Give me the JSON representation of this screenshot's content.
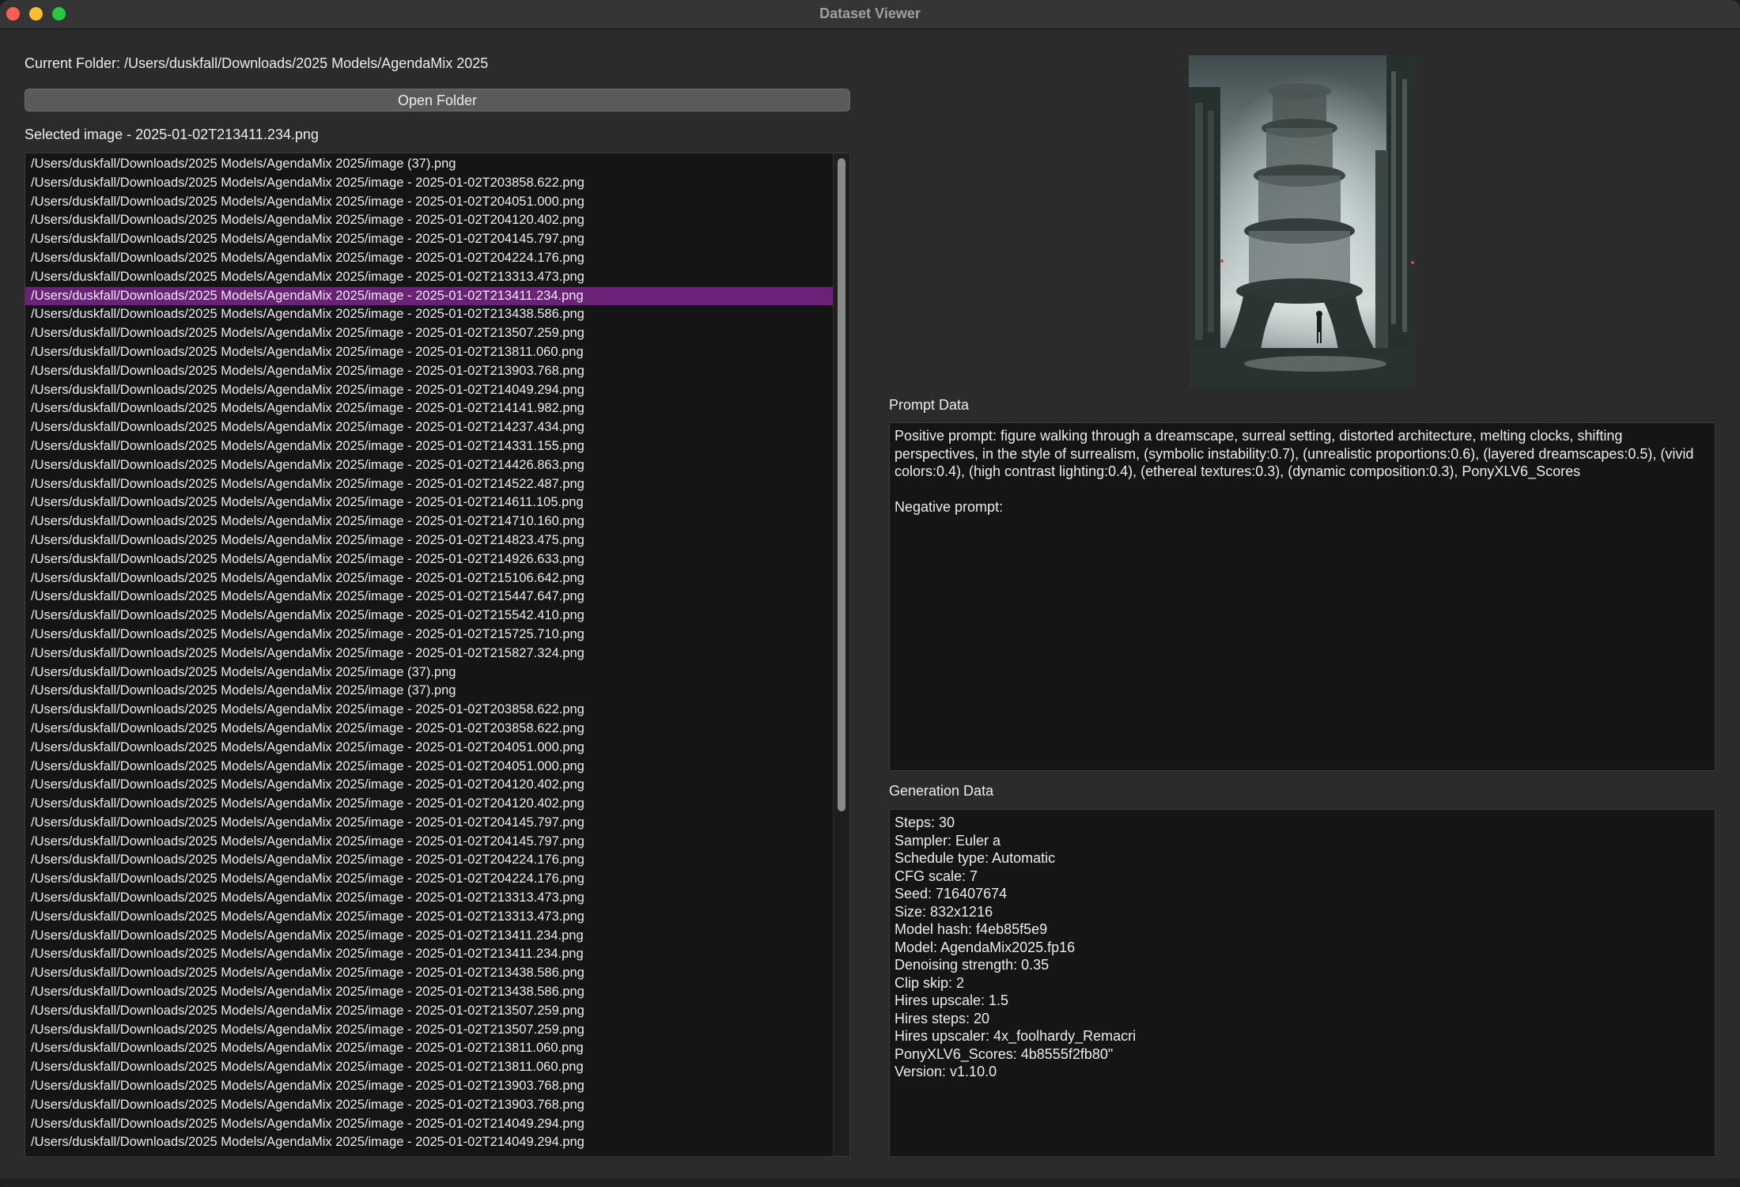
{
  "window": {
    "title": "Dataset Viewer"
  },
  "folder": {
    "current_label": "Current Folder: /Users/duskfall/Downloads/2025 Models/AgendaMix 2025",
    "open_button": "Open Folder",
    "selected_label": "Selected image - 2025-01-02T213411.234.png"
  },
  "files": {
    "selected_index": 7,
    "items": [
      "/Users/duskfall/Downloads/2025 Models/AgendaMix 2025/image (37).png",
      "/Users/duskfall/Downloads/2025 Models/AgendaMix 2025/image - 2025-01-02T203858.622.png",
      "/Users/duskfall/Downloads/2025 Models/AgendaMix 2025/image - 2025-01-02T204051.000.png",
      "/Users/duskfall/Downloads/2025 Models/AgendaMix 2025/image - 2025-01-02T204120.402.png",
      "/Users/duskfall/Downloads/2025 Models/AgendaMix 2025/image - 2025-01-02T204145.797.png",
      "/Users/duskfall/Downloads/2025 Models/AgendaMix 2025/image - 2025-01-02T204224.176.png",
      "/Users/duskfall/Downloads/2025 Models/AgendaMix 2025/image - 2025-01-02T213313.473.png",
      "/Users/duskfall/Downloads/2025 Models/AgendaMix 2025/image - 2025-01-02T213411.234.png",
      "/Users/duskfall/Downloads/2025 Models/AgendaMix 2025/image - 2025-01-02T213438.586.png",
      "/Users/duskfall/Downloads/2025 Models/AgendaMix 2025/image - 2025-01-02T213507.259.png",
      "/Users/duskfall/Downloads/2025 Models/AgendaMix 2025/image - 2025-01-02T213811.060.png",
      "/Users/duskfall/Downloads/2025 Models/AgendaMix 2025/image - 2025-01-02T213903.768.png",
      "/Users/duskfall/Downloads/2025 Models/AgendaMix 2025/image - 2025-01-02T214049.294.png",
      "/Users/duskfall/Downloads/2025 Models/AgendaMix 2025/image - 2025-01-02T214141.982.png",
      "/Users/duskfall/Downloads/2025 Models/AgendaMix 2025/image - 2025-01-02T214237.434.png",
      "/Users/duskfall/Downloads/2025 Models/AgendaMix 2025/image - 2025-01-02T214331.155.png",
      "/Users/duskfall/Downloads/2025 Models/AgendaMix 2025/image - 2025-01-02T214426.863.png",
      "/Users/duskfall/Downloads/2025 Models/AgendaMix 2025/image - 2025-01-02T214522.487.png",
      "/Users/duskfall/Downloads/2025 Models/AgendaMix 2025/image - 2025-01-02T214611.105.png",
      "/Users/duskfall/Downloads/2025 Models/AgendaMix 2025/image - 2025-01-02T214710.160.png",
      "/Users/duskfall/Downloads/2025 Models/AgendaMix 2025/image - 2025-01-02T214823.475.png",
      "/Users/duskfall/Downloads/2025 Models/AgendaMix 2025/image - 2025-01-02T214926.633.png",
      "/Users/duskfall/Downloads/2025 Models/AgendaMix 2025/image - 2025-01-02T215106.642.png",
      "/Users/duskfall/Downloads/2025 Models/AgendaMix 2025/image - 2025-01-02T215447.647.png",
      "/Users/duskfall/Downloads/2025 Models/AgendaMix 2025/image - 2025-01-02T215542.410.png",
      "/Users/duskfall/Downloads/2025 Models/AgendaMix 2025/image - 2025-01-02T215725.710.png",
      "/Users/duskfall/Downloads/2025 Models/AgendaMix 2025/image - 2025-01-02T215827.324.png",
      "/Users/duskfall/Downloads/2025 Models/AgendaMix 2025/image (37).png",
      "/Users/duskfall/Downloads/2025 Models/AgendaMix 2025/image (37).png",
      "/Users/duskfall/Downloads/2025 Models/AgendaMix 2025/image - 2025-01-02T203858.622.png",
      "/Users/duskfall/Downloads/2025 Models/AgendaMix 2025/image - 2025-01-02T203858.622.png",
      "/Users/duskfall/Downloads/2025 Models/AgendaMix 2025/image - 2025-01-02T204051.000.png",
      "/Users/duskfall/Downloads/2025 Models/AgendaMix 2025/image - 2025-01-02T204051.000.png",
      "/Users/duskfall/Downloads/2025 Models/AgendaMix 2025/image - 2025-01-02T204120.402.png",
      "/Users/duskfall/Downloads/2025 Models/AgendaMix 2025/image - 2025-01-02T204120.402.png",
      "/Users/duskfall/Downloads/2025 Models/AgendaMix 2025/image - 2025-01-02T204145.797.png",
      "/Users/duskfall/Downloads/2025 Models/AgendaMix 2025/image - 2025-01-02T204145.797.png",
      "/Users/duskfall/Downloads/2025 Models/AgendaMix 2025/image - 2025-01-02T204224.176.png",
      "/Users/duskfall/Downloads/2025 Models/AgendaMix 2025/image - 2025-01-02T204224.176.png",
      "/Users/duskfall/Downloads/2025 Models/AgendaMix 2025/image - 2025-01-02T213313.473.png",
      "/Users/duskfall/Downloads/2025 Models/AgendaMix 2025/image - 2025-01-02T213313.473.png",
      "/Users/duskfall/Downloads/2025 Models/AgendaMix 2025/image - 2025-01-02T213411.234.png",
      "/Users/duskfall/Downloads/2025 Models/AgendaMix 2025/image - 2025-01-02T213411.234.png",
      "/Users/duskfall/Downloads/2025 Models/AgendaMix 2025/image - 2025-01-02T213438.586.png",
      "/Users/duskfall/Downloads/2025 Models/AgendaMix 2025/image - 2025-01-02T213438.586.png",
      "/Users/duskfall/Downloads/2025 Models/AgendaMix 2025/image - 2025-01-02T213507.259.png",
      "/Users/duskfall/Downloads/2025 Models/AgendaMix 2025/image - 2025-01-02T213507.259.png",
      "/Users/duskfall/Downloads/2025 Models/AgendaMix 2025/image - 2025-01-02T213811.060.png",
      "/Users/duskfall/Downloads/2025 Models/AgendaMix 2025/image - 2025-01-02T213811.060.png",
      "/Users/duskfall/Downloads/2025 Models/AgendaMix 2025/image - 2025-01-02T213903.768.png",
      "/Users/duskfall/Downloads/2025 Models/AgendaMix 2025/image - 2025-01-02T213903.768.png",
      "/Users/duskfall/Downloads/2025 Models/AgendaMix 2025/image - 2025-01-02T214049.294.png",
      "/Users/duskfall/Downloads/2025 Models/AgendaMix 2025/image - 2025-01-02T214049.294.png"
    ]
  },
  "prompt": {
    "heading": "Prompt Data",
    "positive": "Positive prompt: figure walking through a dreamscape, surreal setting, distorted architecture, melting clocks, shifting perspectives, in the style of surrealism, (symbolic instability:0.7), (unrealistic proportions:0.6), (layered dreamscapes:0.5), (vivid colors:0.4), (high contrast lighting:0.4), (ethereal textures:0.3), (dynamic composition:0.3), PonyXLV6_Scores",
    "negative": "Negative prompt:"
  },
  "generation": {
    "heading": "Generation Data",
    "lines": [
      "Steps: 30",
      "Sampler: Euler a",
      "Schedule type: Automatic",
      "CFG scale: 7",
      "Seed: 716407674",
      "Size: 832x1216",
      "Model hash: f4eb85f5e9",
      "Model: AgendaMix2025.fp16",
      "Denoising strength: 0.35",
      "Clip skip: 2",
      "Hires upscale: 1.5",
      "Hires steps: 20",
      "Hires upscaler: 4x_foolhardy_Remacri",
      "PonyXLV6_Scores: 4b8555f2fb80\"",
      "Version: v1.10.0"
    ]
  },
  "colors": {
    "selection": "#6a2178",
    "window_bg": "#2b2b2b",
    "panel_bg": "#151515"
  }
}
